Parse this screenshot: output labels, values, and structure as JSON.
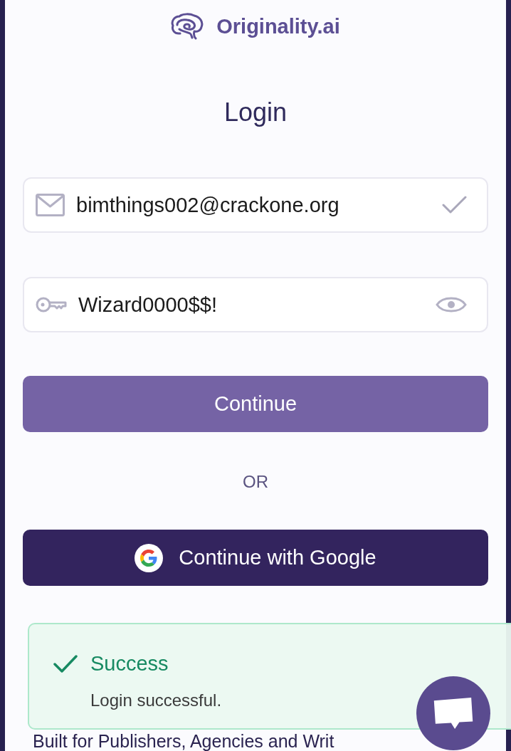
{
  "logo": {
    "text": "Originality.ai"
  },
  "title": "Login",
  "fields": [
    {
      "kind": "email",
      "value": "bimthings002@crackone.org",
      "valid": true
    },
    {
      "kind": "password",
      "value": "Wizard0000$$!"
    }
  ],
  "continue_button": {
    "label": "Continue"
  },
  "divider": {
    "label": "OR"
  },
  "google_button": {
    "label": "Continue with Google"
  },
  "footer": {
    "tagline": "Built for Publishers, Agencies and Writ"
  },
  "toast": {
    "kind": "success",
    "title": "Success",
    "message": "Login successful."
  }
}
